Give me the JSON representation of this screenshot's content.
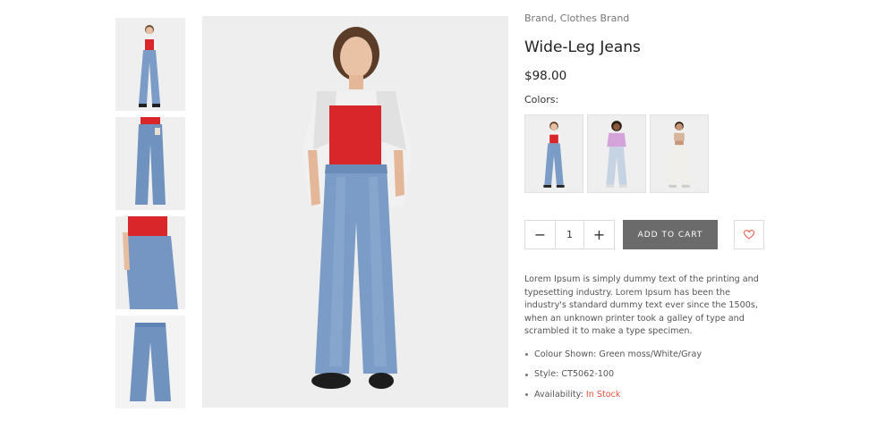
{
  "product": {
    "brand": "Brand, Clothes Brand",
    "title": "Wide-Leg Jeans",
    "price": "$98.00"
  },
  "colors": {
    "label": "Colors:",
    "swatches": [
      {
        "name": "Green moss",
        "top_color": "#d8262b",
        "jeans_color": "#7a9cc6"
      },
      {
        "name": "White",
        "top_color": "#d4a3d9",
        "jeans_color": "#c6d3e3"
      },
      {
        "name": "Gray",
        "top_color": "#d8b59a",
        "jeans_color": "#f0efe9"
      }
    ]
  },
  "cart": {
    "minus_label": "−",
    "quantity": "1",
    "plus_label": "+",
    "add_label": "ADD TO CART",
    "wishlist_icon": "heart-icon"
  },
  "description": "Lorem Ipsum is simply dummy text of the printing and typesetting industry. Lorem Ipsum has been the industry's standard dummy text ever since the 1500s, when an unknown printer took a galley of type and scrambled it to make a type specimen.",
  "specs": {
    "colour_shown": "Colour Shown: Green moss/White/Gray",
    "style": "Style: CT5062-100",
    "availability_label": "Availability:",
    "availability_value": "In Stock"
  },
  "theme": {
    "accent": "#e5533d",
    "button": "#6b6b6b",
    "denim": "#7a9cc6",
    "top": "#d8262b"
  }
}
